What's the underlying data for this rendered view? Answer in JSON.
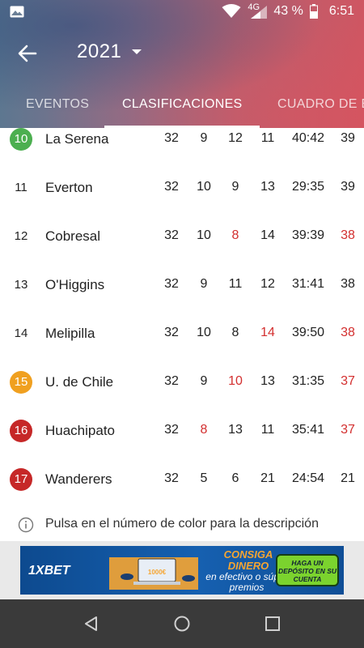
{
  "status_bar": {
    "network": "4G",
    "battery": "43 %",
    "time": "6:51"
  },
  "toolbar": {
    "year": "2021"
  },
  "tabs": [
    {
      "label": "EVENTOS",
      "active": false
    },
    {
      "label": "CLASIFICACIONES",
      "active": true
    },
    {
      "label": "CUADRO DE E",
      "active": false
    }
  ],
  "standings": [
    {
      "pos": "10",
      "badge_color": "#4caf50",
      "team": "La Serena",
      "pj": "32",
      "g": "9",
      "e": "12",
      "p": "11",
      "goles": "40:42",
      "pts": "39",
      "red": []
    },
    {
      "pos": "11",
      "badge_color": "",
      "team": "Everton",
      "pj": "32",
      "g": "10",
      "e": "9",
      "p": "13",
      "goles": "29:35",
      "pts": "39",
      "red": []
    },
    {
      "pos": "12",
      "badge_color": "",
      "team": "Cobresal",
      "pj": "32",
      "g": "10",
      "e": "8",
      "p": "14",
      "goles": "39:39",
      "pts": "38",
      "red": [
        "e",
        "pts"
      ]
    },
    {
      "pos": "13",
      "badge_color": "",
      "team": "O'Higgins",
      "pj": "32",
      "g": "9",
      "e": "11",
      "p": "12",
      "goles": "31:41",
      "pts": "38",
      "red": []
    },
    {
      "pos": "14",
      "badge_color": "",
      "team": "Melipilla",
      "pj": "32",
      "g": "10",
      "e": "8",
      "p": "14",
      "goles": "39:50",
      "pts": "38",
      "red": [
        "p",
        "pts"
      ]
    },
    {
      "pos": "15",
      "badge_color": "#f0a020",
      "team": "U. de Chile",
      "pj": "32",
      "g": "9",
      "e": "10",
      "p": "13",
      "goles": "31:35",
      "pts": "37",
      "red": [
        "e",
        "pts"
      ]
    },
    {
      "pos": "16",
      "badge_color": "#c62828",
      "team": "Huachipato",
      "pj": "32",
      "g": "8",
      "e": "13",
      "p": "11",
      "goles": "35:41",
      "pts": "37",
      "red": [
        "g",
        "pts"
      ]
    },
    {
      "pos": "17",
      "badge_color": "#c62828",
      "team": "Wanderers",
      "pj": "32",
      "g": "5",
      "e": "6",
      "p": "21",
      "goles": "24:54",
      "pts": "21",
      "red": []
    }
  ],
  "footnote": {
    "text": "Pulsa en el número de color para la descripción"
  },
  "ad": {
    "brand": "1XBET",
    "headline": "CONSIGA DINERO",
    "subline": "en efectivo o súper premios",
    "cta": "HAGA UN DEPÓSITO EN SU CUENTA",
    "amount": "1000€",
    "colors": {
      "bg": "#1660b0",
      "accent": "#f6a531",
      "cta": "#7bd32e"
    }
  },
  "colors": {
    "red_value": "#d32f2f",
    "header_left": "#5d7790",
    "header_right": "#cf5662"
  }
}
